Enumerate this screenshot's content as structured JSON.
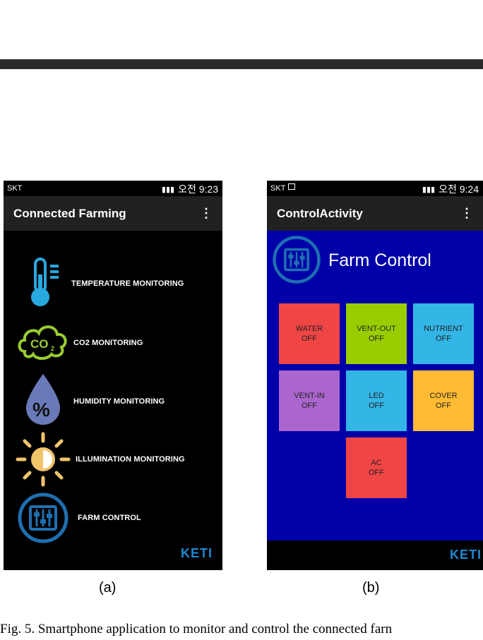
{
  "phone_a": {
    "status": {
      "carrier": "SKT",
      "time": "오전 9:23"
    },
    "appbar": {
      "title": "Connected Farming"
    },
    "items": [
      {
        "label": "TEMPERATURE MONITORING"
      },
      {
        "label": "CO2 MONITORING"
      },
      {
        "label": "HUMIDITY MONITORING"
      },
      {
        "label": "ILLUMINATION MONITORING"
      },
      {
        "label": "FARM CONTROL"
      }
    ],
    "logo": "KETI"
  },
  "phone_b": {
    "status": {
      "carrier": "SKT",
      "time": "오전 9:24"
    },
    "appbar": {
      "title": "ControlActivity"
    },
    "heading": "Farm Control",
    "tiles": [
      {
        "name": "WATER",
        "state": "OFF",
        "color": "#f04545"
      },
      {
        "name": "VENT-OUT",
        "state": "OFF",
        "color": "#9acd00"
      },
      {
        "name": "NUTRIENT",
        "state": "OFF",
        "color": "#33b5e5"
      },
      {
        "name": "VENT-IN",
        "state": "OFF",
        "color": "#aa66cc"
      },
      {
        "name": "LED",
        "state": "OFF",
        "color": "#33b5e5"
      },
      {
        "name": "COVER",
        "state": "OFF",
        "color": "#ffbb33"
      },
      {
        "name": "AC",
        "state": "OFF",
        "color": "#f04545"
      }
    ],
    "logo": "KETI"
  },
  "captions": {
    "a": "(a)",
    "b": "(b)"
  },
  "figure_caption": "Fig. 5.   Smartphone application to monitor and control the connected farn",
  "colors": {
    "accent_blue": "#0000a8",
    "icon_blue": "#29a8e0"
  }
}
